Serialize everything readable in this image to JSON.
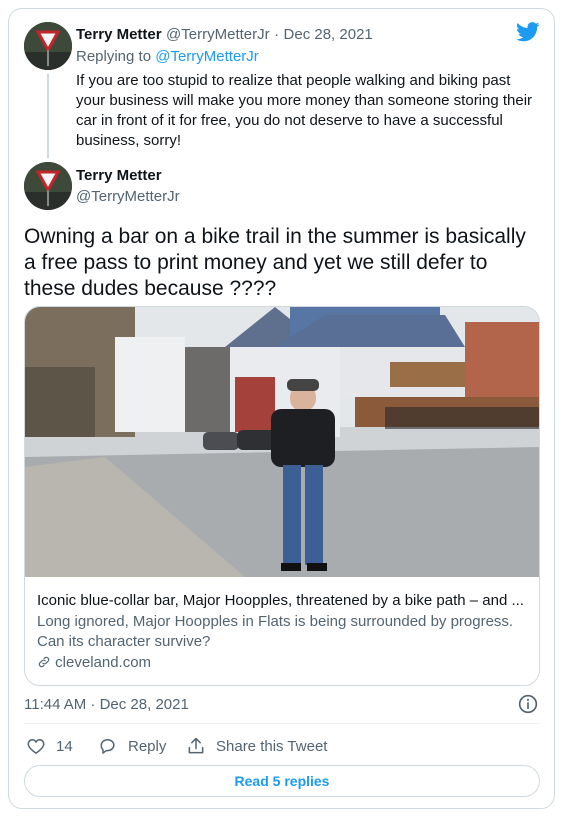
{
  "reply_tweet": {
    "author_name": "Terry Metter",
    "author_handle": "@TerryMetterJr",
    "separator": "·",
    "date": "Dec 28, 2021",
    "replying_prefix": "Replying to",
    "replying_handle": "@TerryMetterJr",
    "text": "If you are too stupid to realize that people walking and biking past your business will make you more money than someone storing their car in front of it for free, you do not deserve to have a successful business, sorry!"
  },
  "main_tweet": {
    "author_name": "Terry Metter",
    "author_handle": "@TerryMetterJr",
    "text": "Owning a bar on a bike trail in the summer is basically a free pass to print money and yet we still defer to these dudes because ????",
    "card": {
      "title": "Iconic blue-collar bar, Major Hoopples, threatened by a bike path – and ...",
      "description": "Long ignored, Major Hoopples in Flats is being surrounded by progress. Can its character survive?",
      "domain": "cleveland.com"
    },
    "timestamp": "11:44 AM · Dec 28, 2021",
    "likes": "14",
    "reply_label": "Reply",
    "share_label": "Share this Tweet",
    "read_replies": "Read 5 replies"
  },
  "icons": {
    "brand": "twitter-bird-icon",
    "info": "info-icon",
    "like": "heart-icon",
    "reply": "reply-bubble-icon",
    "share": "share-icon",
    "link": "link-icon"
  },
  "colors": {
    "accent": "#1d9bf0",
    "secondary_text": "#536471",
    "border": "#cfd9de"
  }
}
